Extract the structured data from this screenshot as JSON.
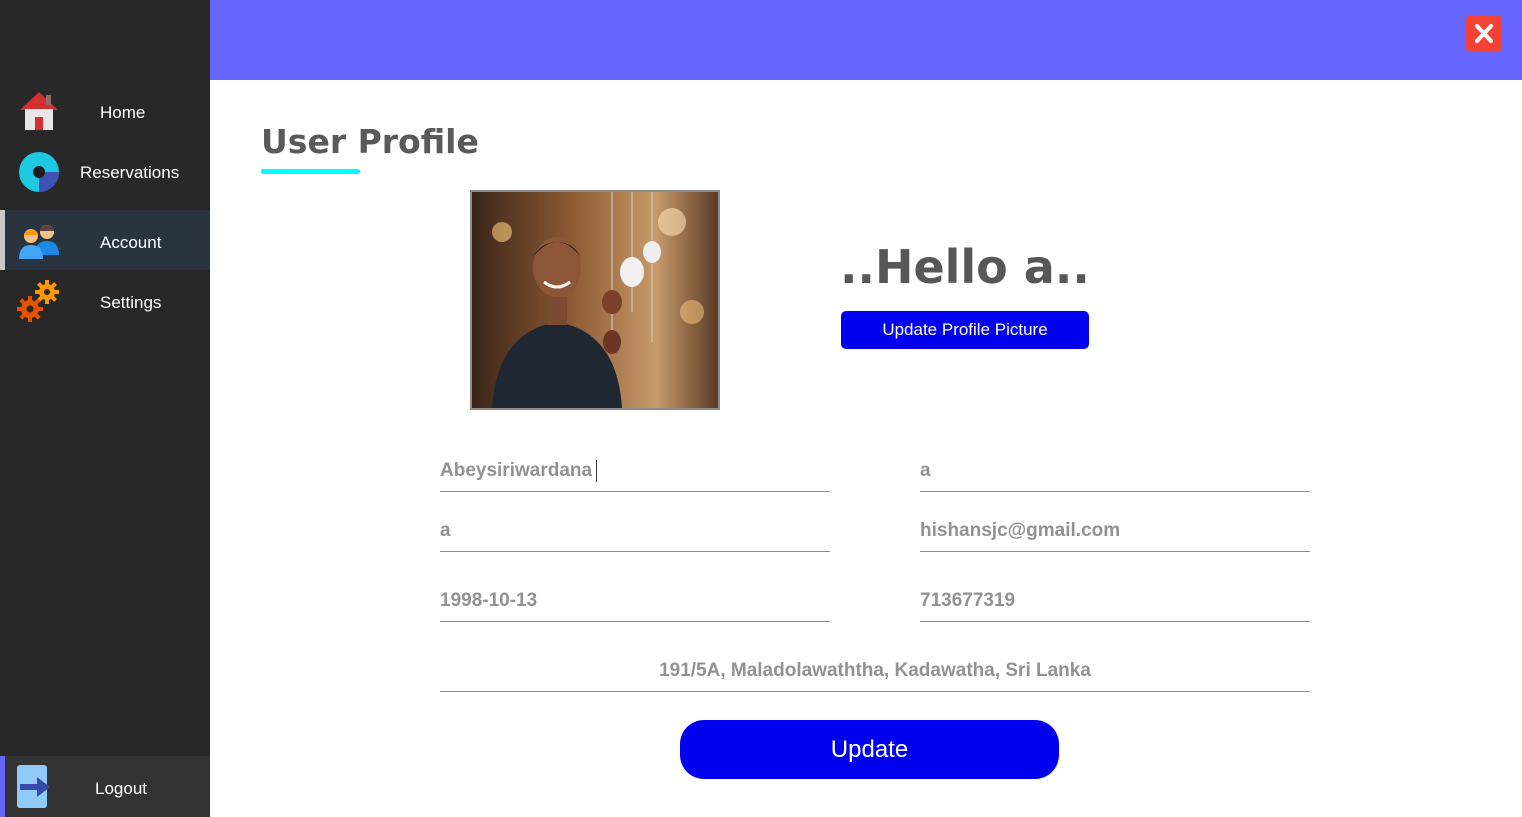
{
  "sidebar": {
    "items": [
      {
        "label": "Home",
        "icon": "house-icon",
        "active": false
      },
      {
        "label": "Reservations",
        "icon": "pie-chart-icon",
        "active": false
      },
      {
        "label": "Account",
        "icon": "users-icon",
        "active": true
      },
      {
        "label": "Settings",
        "icon": "gears-icon",
        "active": false
      }
    ],
    "logout_label": "Logout",
    "logout_icon": "logout-arrow-icon"
  },
  "topbar": {
    "close_icon": "close-icon",
    "color": "#6666ff"
  },
  "main": {
    "title": "User Profile",
    "greeting": "..Hello a..",
    "upload_button": "Update Profile Picture",
    "fields": {
      "last_name": "Abeysiriwardana",
      "first_name": "a",
      "username": "a",
      "email": "hishansjc@gmail.com",
      "birthday": "1998-10-13",
      "phone": "713677319",
      "address": "191/5A, Maladolawaththa, Kadawatha, Sri Lanka"
    },
    "update_button": "Update"
  },
  "colors": {
    "accent": "#0000ee",
    "sidebar_bg": "#282828",
    "underline": "#00ffff",
    "close_bg": "#f44336"
  }
}
